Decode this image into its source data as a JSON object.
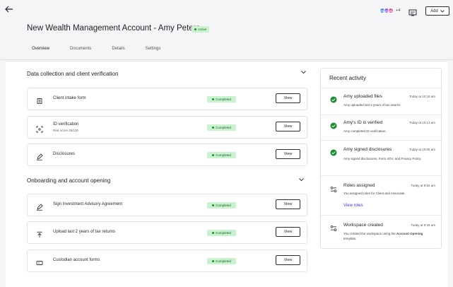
{
  "header": {
    "back_icon": "arrow-left-icon",
    "avatars": [
      {
        "initials": "PA",
        "color": "#3f8cf0"
      },
      {
        "initials": "DJ",
        "color": "#8e5cf2"
      },
      {
        "initials": "IN",
        "color": "#e0559b"
      }
    ],
    "avatars_more": "+4",
    "workspace_icon": "workspace-icon",
    "add_label": "Add",
    "title": "New Wealth Management Account - Amy Peters",
    "status": "Active"
  },
  "tabs": [
    {
      "label": "Overview",
      "active": true
    },
    {
      "label": "Documents",
      "active": false
    },
    {
      "label": "Details",
      "active": false
    },
    {
      "label": "Settings",
      "active": false
    }
  ],
  "sections": [
    {
      "title": "Data collection and client verification",
      "items": [
        {
          "label": "Client intake form",
          "sub": "",
          "icon": "form-icon",
          "status": "Completed",
          "action": "View"
        },
        {
          "label": "ID verification",
          "sub": "Risk score 25/100",
          "icon": "scan-face-icon",
          "status": "Completed",
          "action": "View"
        },
        {
          "label": "Disclosures",
          "sub": "",
          "icon": "signature-icon",
          "status": "Completed",
          "action": "View"
        }
      ]
    },
    {
      "title": "Onboarding and account opening",
      "items": [
        {
          "label": "Sign Investment Advisory Agreement",
          "sub": "",
          "icon": "signature-icon",
          "status": "Completed",
          "action": "View"
        },
        {
          "label": "Upload last 2 years of tax returns",
          "sub": "",
          "icon": "upload-icon",
          "status": "Completed",
          "action": "View"
        },
        {
          "label": "Custodian account forms",
          "sub": "",
          "icon": "card-icon",
          "status": "Completed",
          "action": "View"
        }
      ]
    }
  ],
  "activity": {
    "title": "Recent activity",
    "items": [
      {
        "icon": "check-circle-icon",
        "title": "Amy uploaded files",
        "time": "Today at 10:18 am",
        "desc": "Amy uploaded last 2 years of tax returns",
        "link": ""
      },
      {
        "icon": "check-circle-icon",
        "title": "Amy's ID is verified",
        "time": "Today at 10:13 am",
        "desc": "Amy completed ID verification.",
        "link": ""
      },
      {
        "icon": "check-circle-icon",
        "title": "Amy signed disclosures",
        "time": "Today at 10:05 am",
        "desc": "Amy signed disclosures, Form ADV, and Privacy Policy.",
        "link": ""
      },
      {
        "icon": "roles-icon",
        "title": "Roles assigned",
        "time": "Today at 9:54 am",
        "desc": "You assigned roles for Client and Associate.",
        "link": "View roles"
      },
      {
        "icon": "roles-icon",
        "title": "Workspace created",
        "time": "Today at 9:26 am",
        "desc_prefix": "You created the workspace using the ",
        "desc_bold": "Account Opening",
        "desc_suffix": " template.",
        "link": ""
      }
    ]
  },
  "colors": {
    "accent": "#4b2fe0",
    "success": "#1e8c34",
    "success_bg": "#c9f2cf"
  }
}
